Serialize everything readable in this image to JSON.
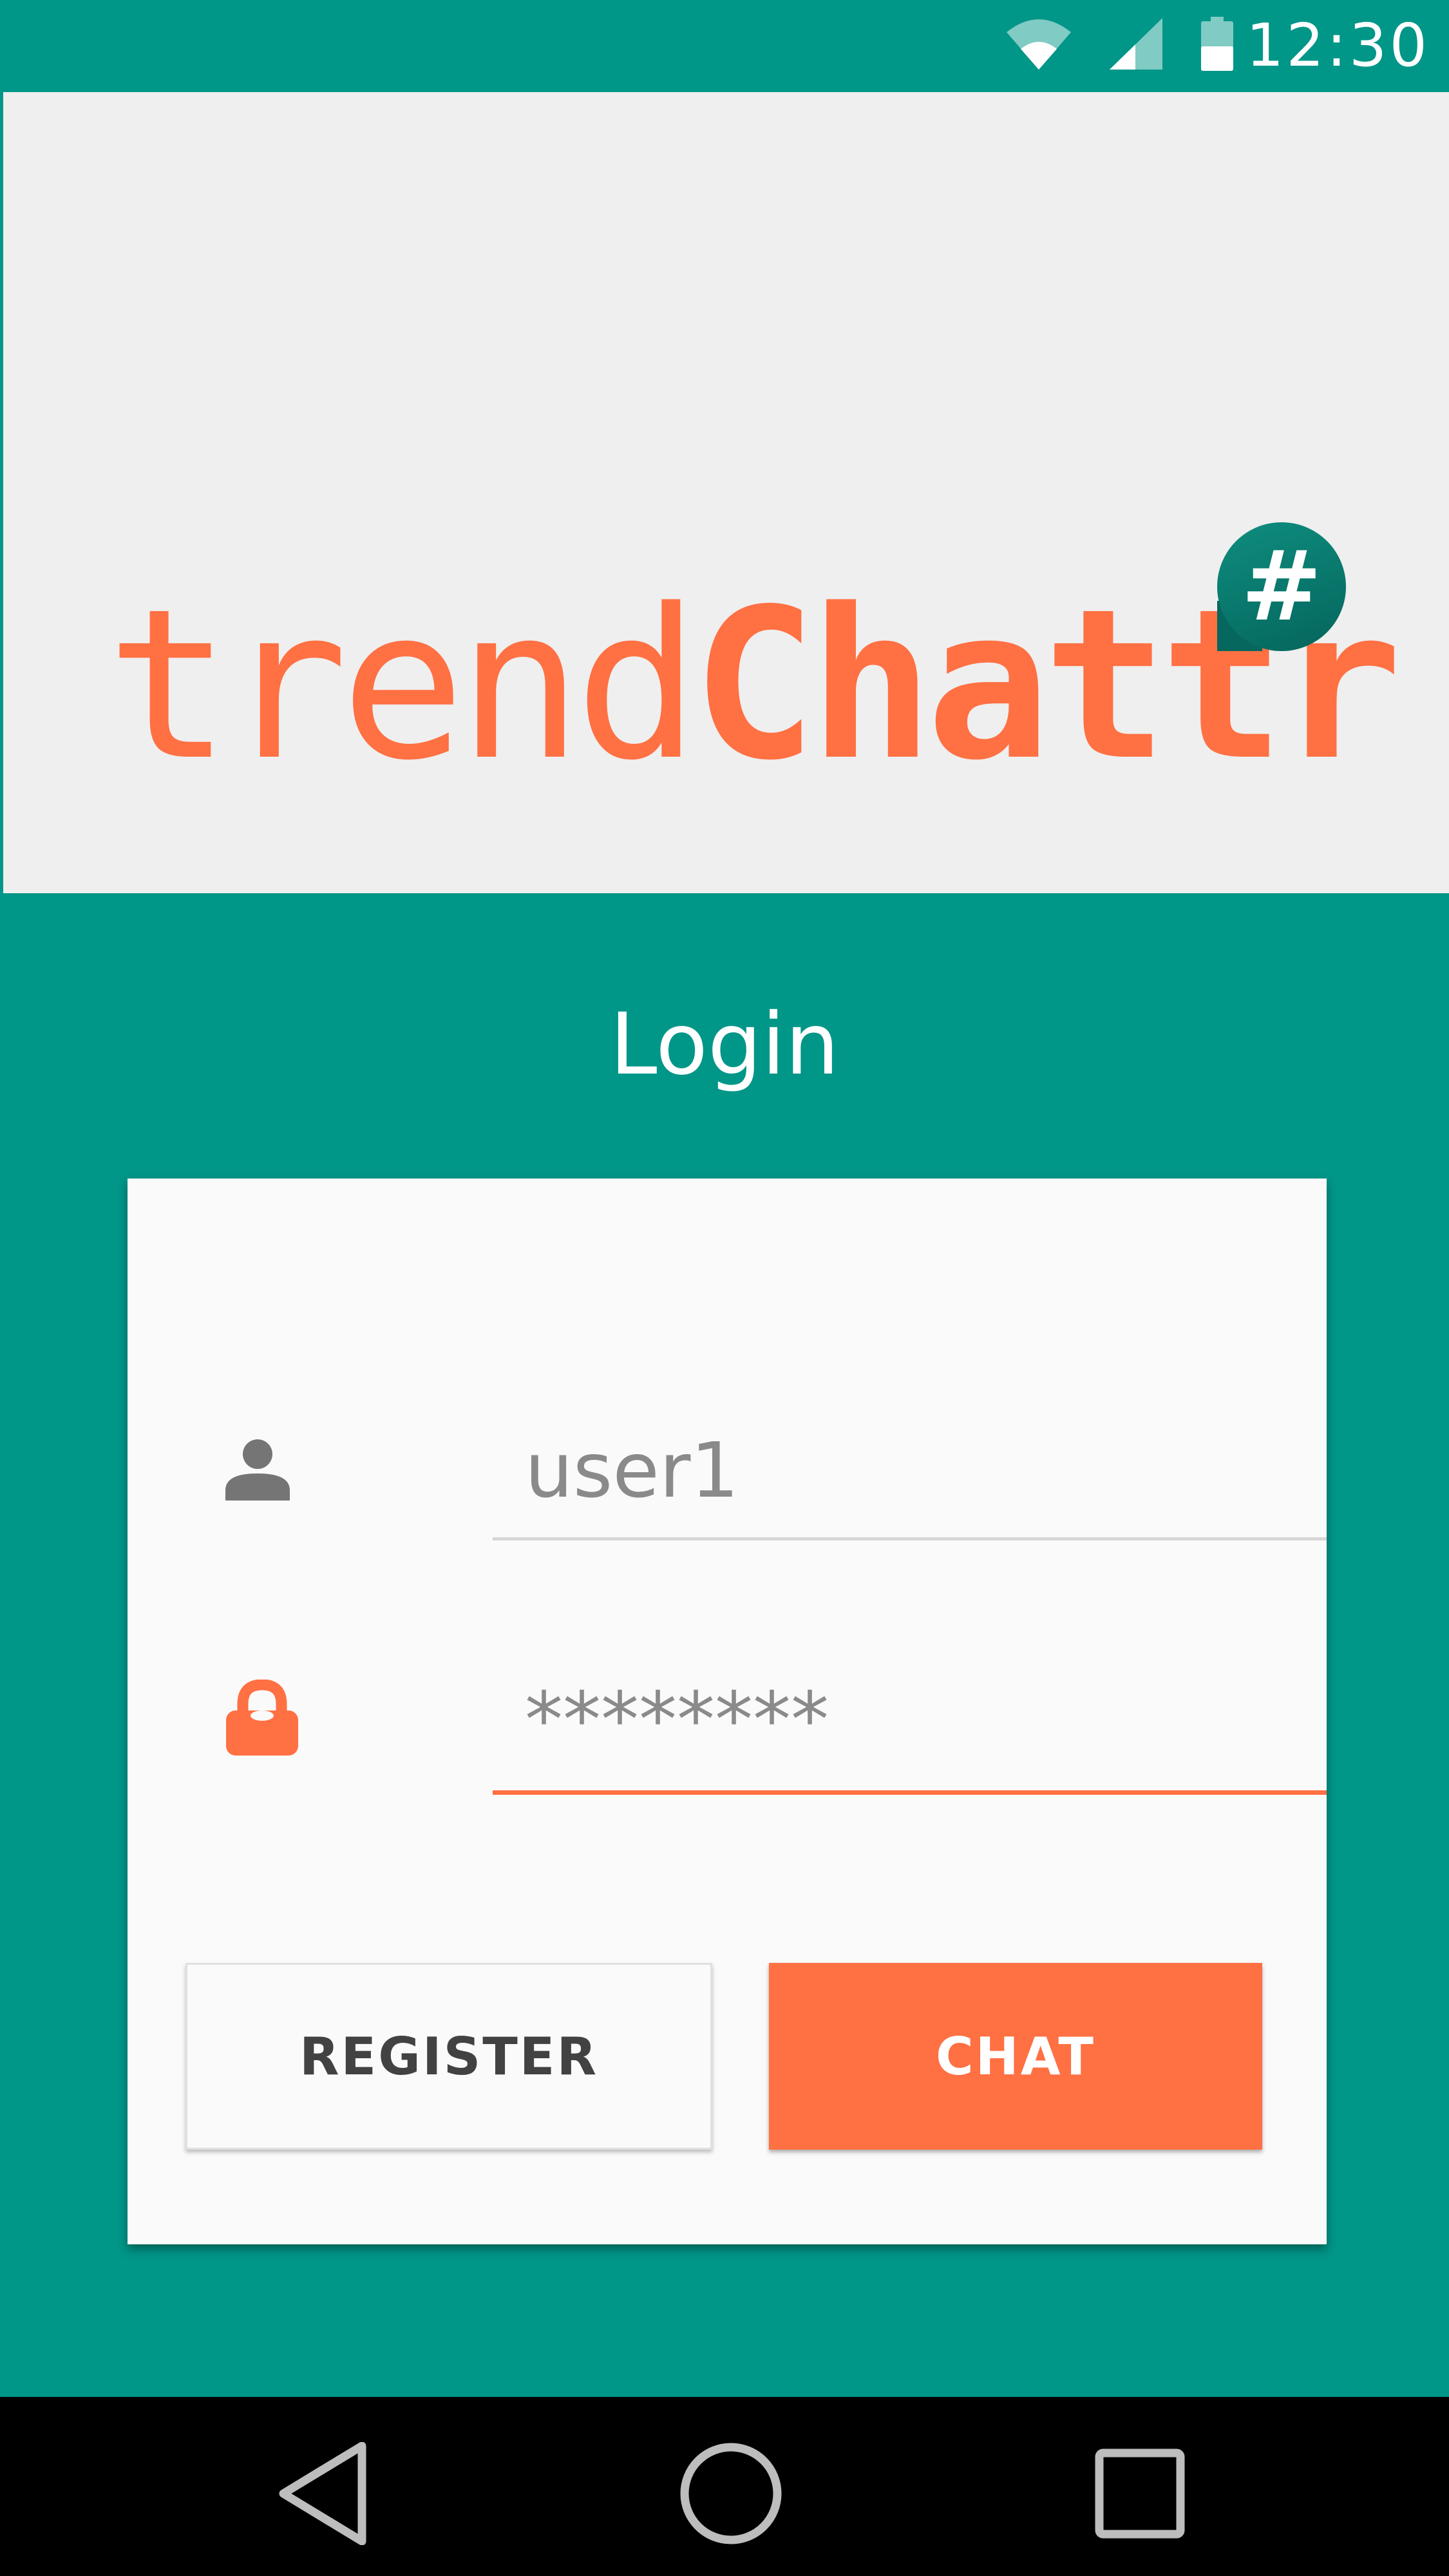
{
  "status_bar": {
    "time": "12:30",
    "icons": [
      "wifi-icon",
      "cellular-signal-icon",
      "battery-icon"
    ],
    "background": "#009688"
  },
  "logo": {
    "text_light": "trend",
    "text_bold": "Chattr",
    "badge": "#",
    "color": "#ff7043",
    "badge_color": "#00796b"
  },
  "login": {
    "title": "Login",
    "username": {
      "value": "user1",
      "icon": "person-icon"
    },
    "password": {
      "value": "********",
      "icon": "lock-icon"
    },
    "buttons": {
      "register": "REGISTER",
      "chat": "CHAT"
    }
  },
  "nav_bar": {
    "icons": [
      "back-icon",
      "home-icon",
      "recents-icon"
    ]
  },
  "colors": {
    "primary": "#009688",
    "accent": "#ff7043",
    "card": "#fafafa"
  }
}
